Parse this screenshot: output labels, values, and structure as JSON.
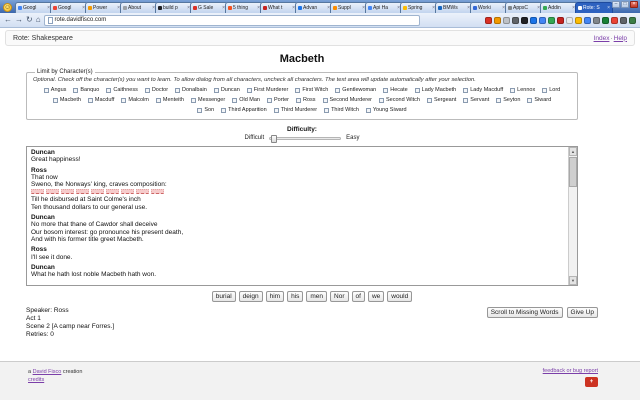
{
  "browser": {
    "smiley_glyph": "☺",
    "tabs": [
      {
        "label": "Googl",
        "favicon": "#4285f4"
      },
      {
        "label": "Googl",
        "favicon": "#ea4335"
      },
      {
        "label": "Power",
        "favicon": "#f29900"
      },
      {
        "label": "About",
        "favicon": "#9aa0a6"
      },
      {
        "label": "build p",
        "favicon": "#202124"
      },
      {
        "label": "G Sale",
        "favicon": "#d93025"
      },
      {
        "label": "5 thing",
        "favicon": "#f4511e"
      },
      {
        "label": "What t",
        "favicon": "#c5221f"
      },
      {
        "label": "Advan",
        "favicon": "#1a73e8"
      },
      {
        "label": "Suppl",
        "favicon": "#fb8c00"
      },
      {
        "label": "Api Ha",
        "favicon": "#4285f4"
      },
      {
        "label": "Spring",
        "favicon": "#fbbc04"
      },
      {
        "label": "BMWs",
        "favicon": "#1565c0"
      },
      {
        "label": "Worki",
        "favicon": "#3367d6"
      },
      {
        "label": "AppsC",
        "favicon": "#80868b"
      },
      {
        "label": "Addin",
        "favicon": "#34a853"
      },
      {
        "label": "Rote: S",
        "favicon": "#ffffff",
        "active": true
      }
    ],
    "window_controls": {
      "minimize": "–",
      "maximize": "□",
      "close": "×"
    },
    "nav_icons": {
      "back": "←",
      "forward": "→",
      "refresh": "↻",
      "home": "⌂"
    },
    "url": "rote.davidfisco.com",
    "extensions": [
      "#d93025",
      "#f29900",
      "#bdc1c6",
      "#5f6368",
      "#202124",
      "#1a73e8",
      "#4285f4",
      "#34a853",
      "#c5221f",
      "#e8eaed",
      "#fbbc04",
      "#4285f4",
      "#80868b",
      "#188038",
      "#ea4335",
      "#5f6368",
      "#3c7d46"
    ]
  },
  "page": {
    "site_title": "Rote: Shakespeare",
    "nav": {
      "index_label": "Index",
      "separator": "·",
      "help_label": "Help"
    },
    "title": "Macbeth",
    "filter": {
      "legend": "Limit by Character(s)",
      "instructions": "Optional. Check off the character(s) you want to learn. To allow dialog from all characters, uncheck all characters. The text area will update automatically after your selection.",
      "character_rows": [
        [
          "Angus",
          "Banquo",
          "Caithness",
          "Doctor",
          "Donalbain",
          "Duncan",
          "First Murderer",
          "First Witch",
          "Gentlewoman",
          "Hecate",
          "Lady Macbeth",
          "Lady Macduff",
          "Lennox",
          "Lord"
        ],
        [
          "Macbeth",
          "Macduff",
          "Malcolm",
          "Menteith",
          "Messenger",
          "Old Man",
          "Porter",
          "Ross",
          "Second Murderer",
          "Second Witch",
          "Sergeant",
          "Servant",
          "Seyton",
          "Siward"
        ],
        [
          "Son",
          "Third Apparition",
          "Third Murderer",
          "Third Witch",
          "Young Siward"
        ]
      ]
    },
    "difficulty": {
      "label": "Difficulty:",
      "min_label": "Difficult",
      "max_label": "Easy"
    },
    "transcript": [
      {
        "speaker": "Duncan",
        "lines": [
          "Great happiness!"
        ]
      },
      {
        "speaker": "Ross",
        "lines": [
          "That now",
          "Sweno, the Norways' king, craves composition:",
          {
            "blanks": 9
          },
          "Till he disbursed at Saint Colme's inch",
          "Ten thousand dollars to our general use."
        ]
      },
      {
        "speaker": "Duncan",
        "lines": [
          "No more that thane of Cawdor shall deceive",
          "Our bosom interest: go pronounce his present death,",
          "And with his former title greet Macbeth."
        ]
      },
      {
        "speaker": "Ross",
        "lines": [
          "I'll see it done."
        ]
      },
      {
        "speaker": "Duncan",
        "lines": [
          "What he hath lost noble Macbeth hath won."
        ]
      }
    ],
    "word_bank": [
      "burial",
      "deign",
      "him",
      "his",
      "men",
      "Nor",
      "of",
      "we",
      "would"
    ],
    "status": {
      "speaker_label": "Speaker:",
      "speaker_value": "Ross",
      "act_line": "Act 1",
      "scene_line": "Scene 2 [A camp near Forres.]",
      "retries_label": "Retries:",
      "retries_value": "0"
    },
    "actions": {
      "scroll_button": "Scroll to Missing Words",
      "give_up_button": "Give Up"
    },
    "footer": {
      "creation_prefix": "a",
      "creation_link": "David Fisco",
      "creation_suffix": "creation",
      "credits_link": "credits",
      "feedback_link": "feedback or bug report",
      "share_glyph": "+"
    }
  },
  "colors": {
    "link_purple": "#7b3fa9",
    "blank_pink": "#f6cbcb",
    "chrome_blue": "#3c67ad",
    "share_red": "#cc3322"
  }
}
